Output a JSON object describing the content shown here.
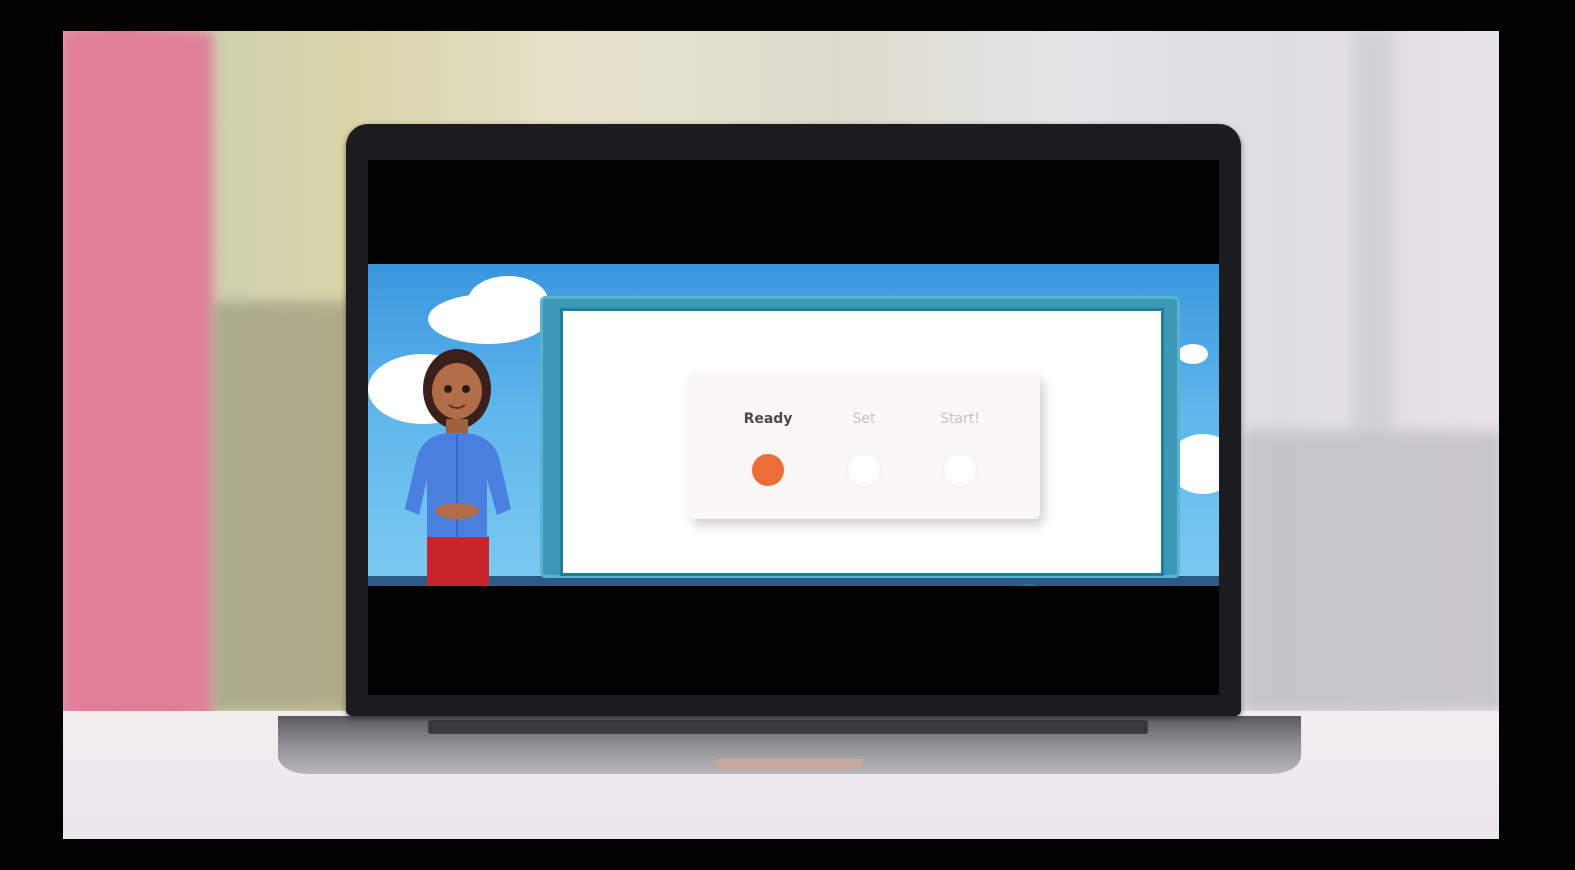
{
  "lesson": {
    "steps": [
      {
        "label": "Ready",
        "active": true
      },
      {
        "label": "Set",
        "active": false
      },
      {
        "label": "Start!",
        "active": false
      }
    ],
    "active_color": "#ee6b3a"
  },
  "icons": {
    "mic": "microphone-icon"
  }
}
